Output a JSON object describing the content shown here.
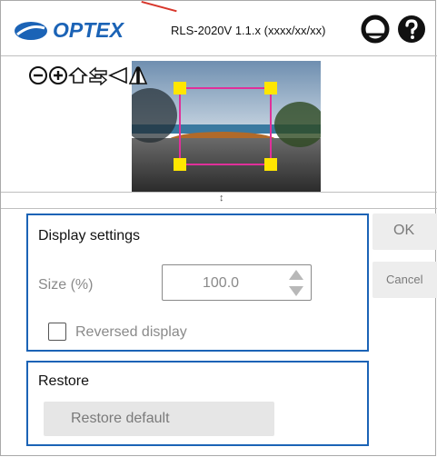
{
  "header": {
    "logo_text": "OPTEX",
    "model_version": "RLS-2020V 1.1.x (xxxx/xx/xx)",
    "icons": [
      "camera-lens-icon",
      "help-icon"
    ]
  },
  "toolbar": {
    "icons": [
      "zoom-out-icon",
      "zoom-in-icon",
      "home-icon",
      "swap-arrows-icon",
      "flip-horizontal-icon",
      "flip-vertical-icon"
    ]
  },
  "divider": {
    "handle": "↕"
  },
  "display_settings": {
    "title": "Display settings",
    "size_label": "Size (%)",
    "size_value": "100.0",
    "reversed_label": "Reversed display",
    "reversed_checked": false
  },
  "restore": {
    "title": "Restore",
    "button_label": "Restore default"
  },
  "actions": {
    "ok_label": "OK",
    "cancel_label": "Cancel"
  },
  "colors": {
    "accent": "#1b63b6",
    "roi_frame": "#e0309a",
    "roi_handle": "#ffe600"
  }
}
